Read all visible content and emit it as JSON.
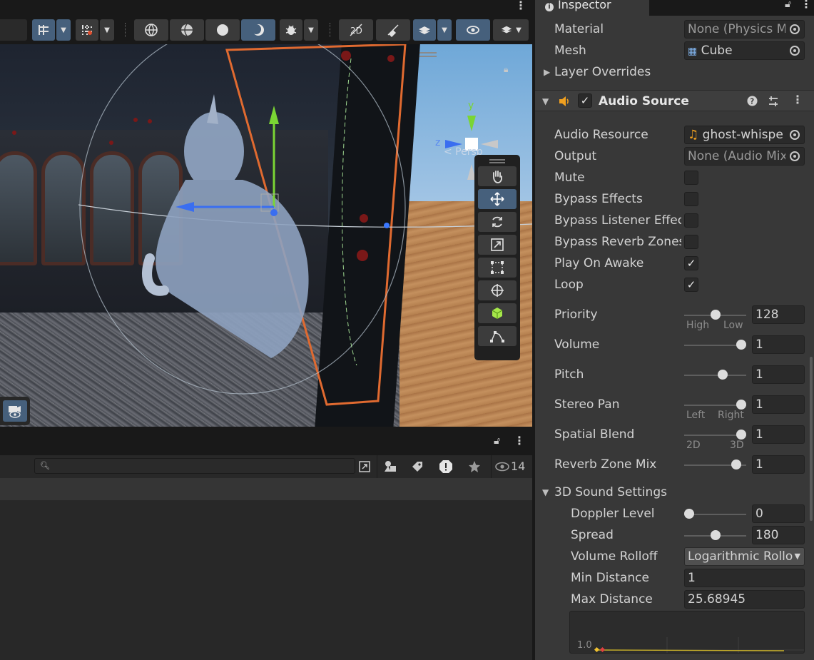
{
  "inspector": {
    "tab_label": "Inspector",
    "material_label": "Material",
    "material_value": "None (Physics M",
    "mesh_label": "Mesh",
    "mesh_value": "Cube",
    "layer_overrides_label": "Layer Overrides",
    "component_title": "Audio Source",
    "audio_resource_label": "Audio Resource",
    "audio_resource_value": "ghost-whispe",
    "output_label": "Output",
    "output_value": "None (Audio Mix",
    "mute_label": "Mute",
    "mute_checked": false,
    "bypass_effects_label": "Bypass Effects",
    "bypass_effects_checked": false,
    "bypass_listener_label": "Bypass Listener Effec",
    "bypass_listener_checked": false,
    "bypass_reverb_label": "Bypass Reverb Zones",
    "bypass_reverb_checked": false,
    "play_on_awake_label": "Play On Awake",
    "play_on_awake_checked": true,
    "loop_label": "Loop",
    "loop_checked": true,
    "priority_label": "Priority",
    "priority_value": "128",
    "priority_fraction": 0.5,
    "priority_low_hint": "High",
    "priority_high_hint": "Low",
    "volume_label": "Volume",
    "volume_value": "1",
    "volume_fraction": 1.0,
    "pitch_label": "Pitch",
    "pitch_value": "1",
    "pitch_fraction": 0.64,
    "stereo_pan_label": "Stereo Pan",
    "stereo_pan_value": "1",
    "stereo_pan_fraction": 1.0,
    "stereo_left_hint": "Left",
    "stereo_right_hint": "Right",
    "spatial_blend_label": "Spatial Blend",
    "spatial_blend_value": "1",
    "spatial_blend_fraction": 1.0,
    "spatial_2d_hint": "2D",
    "spatial_3d_hint": "3D",
    "reverb_mix_label": "Reverb Zone Mix",
    "reverb_mix_value": "1",
    "reverb_mix_fraction": 0.91,
    "sound3d_label": "3D Sound Settings",
    "doppler_label": "Doppler Level",
    "doppler_value": "0",
    "doppler_fraction": 0.0,
    "spread_label": "Spread",
    "spread_value": "180",
    "spread_fraction": 0.5,
    "rolloff_label": "Volume Rolloff",
    "rolloff_value": "Logarithmic Rollo",
    "min_distance_label": "Min Distance",
    "min_distance_value": "1",
    "max_distance_label": "Max Distance",
    "max_distance_value": "25.68945",
    "curve_axis_label": "1.0"
  },
  "scene": {
    "persp_label": "< Persp",
    "axis_y": "y",
    "axis_z": "z"
  },
  "lower": {
    "visibility_count": "14"
  },
  "colors": {
    "accent": "#46607c",
    "panel": "#383838",
    "field": "#2a2a2a",
    "gizmo_x": "#ff3030",
    "gizmo_y": "#7ad534",
    "gizmo_z": "#3a6ef0",
    "speaker_icon": "#f0a020"
  }
}
